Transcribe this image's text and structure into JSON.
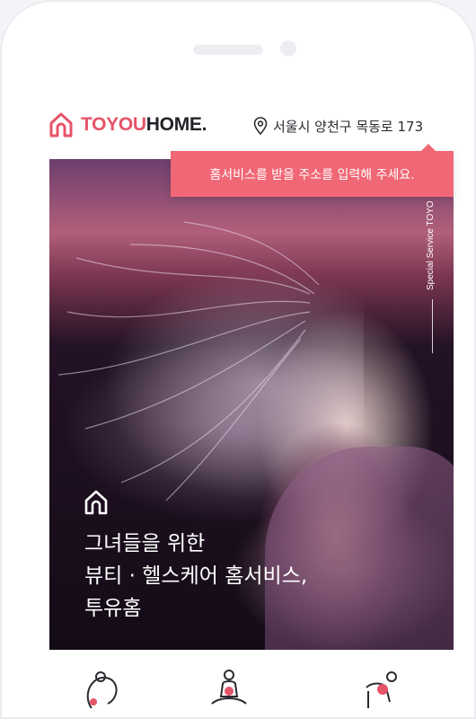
{
  "header": {
    "logo_accent": "TOYOU",
    "logo_dark": "HOME.",
    "address": "서울시 양천구 목동로 173"
  },
  "tooltip": {
    "text": "홈서비스를 받을 주소를 입력해 주세요."
  },
  "hero": {
    "vertical_label": "Special Service TOYO",
    "title_lines": [
      "그녀들을 위한",
      "뷰티 · 헬스케어 홈서비스,",
      "투유홈"
    ]
  },
  "services": [
    {
      "icon": "face-care-icon"
    },
    {
      "icon": "meditation-icon"
    },
    {
      "icon": "massage-icon"
    }
  ],
  "colors": {
    "accent": "#e65468",
    "tooltip": "#f06775",
    "text_dark": "#222328"
  }
}
